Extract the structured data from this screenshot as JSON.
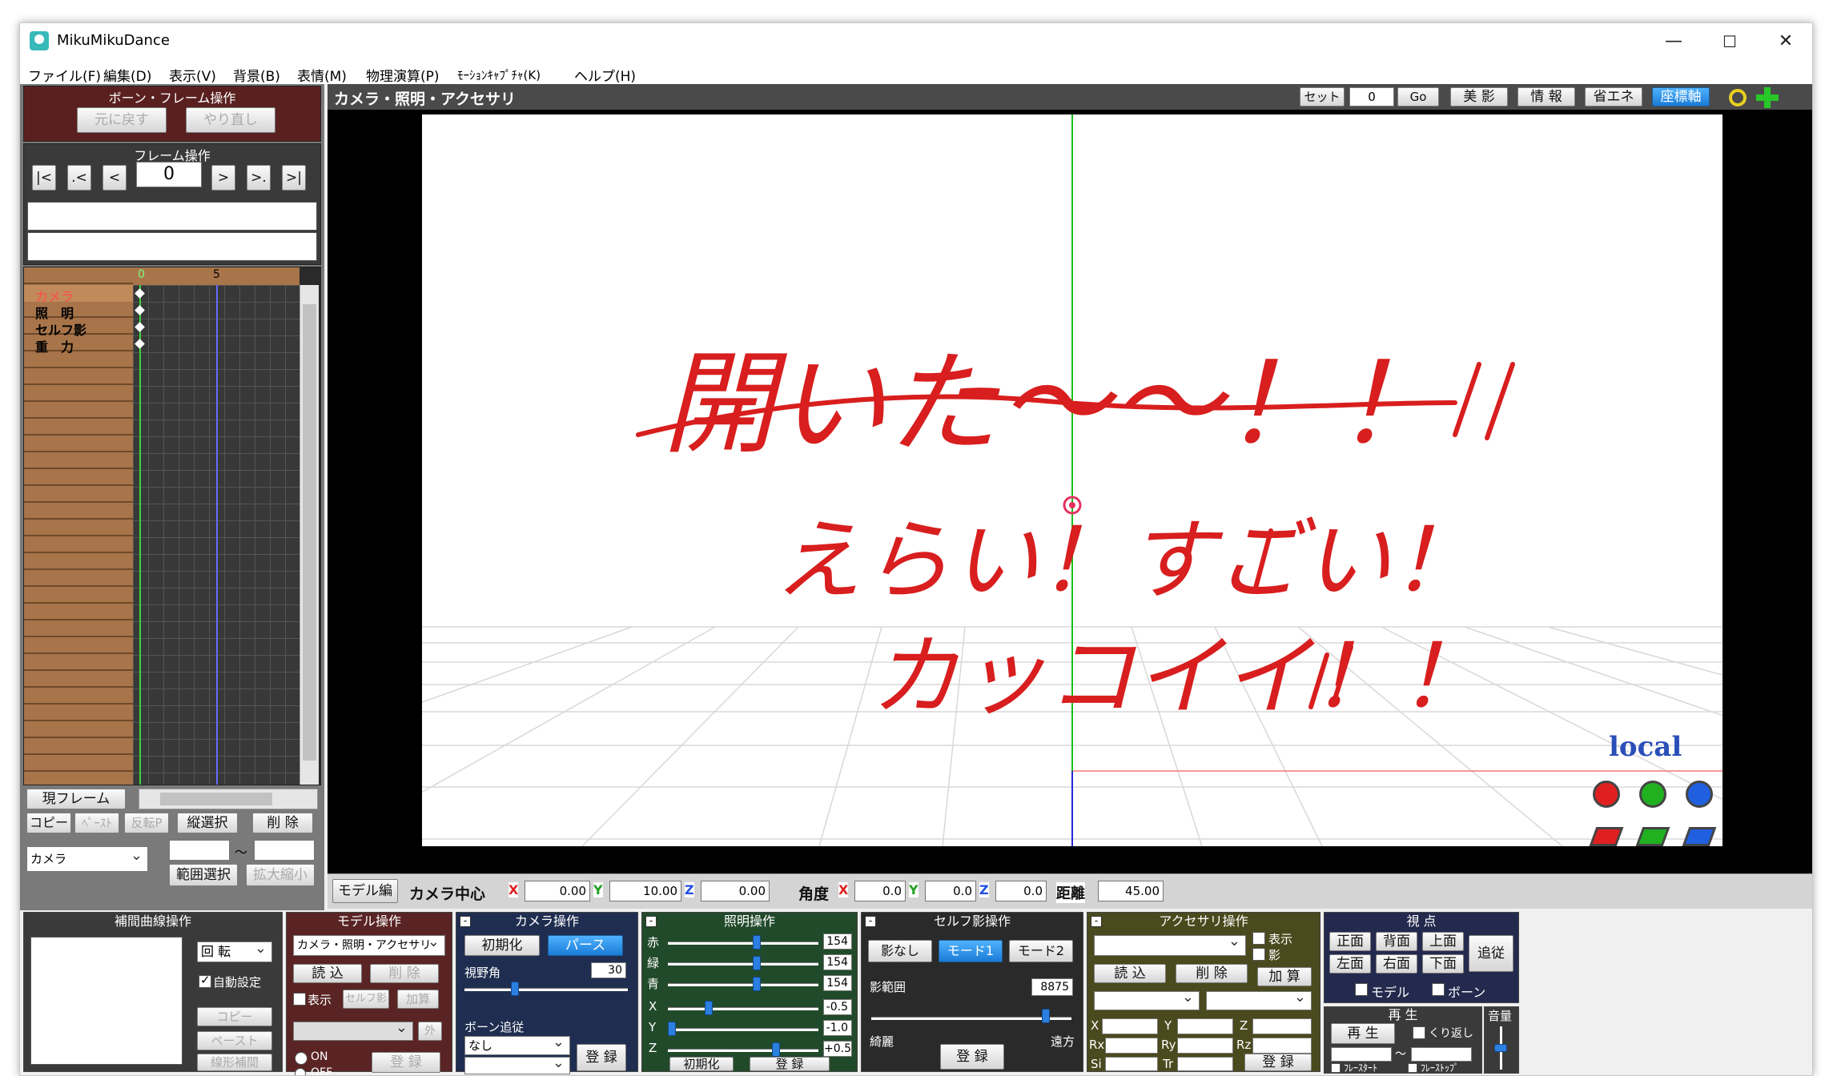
{
  "window": {
    "title": "MikuMikuDance",
    "minimize": "—",
    "maximize": "☐",
    "close": "✕"
  },
  "menu": [
    "ファイル(F)",
    "編集(D)",
    "表示(V)",
    "背景(B)",
    "表情(M)",
    "物理演算(P)",
    "ﾓｰｼｮﾝｷｬﾌﾟﾁｬ(K)",
    "ヘルプ(H)"
  ],
  "bone_frame": {
    "title": "ボーン・フレーム操作",
    "undo": "元に戻す",
    "redo": "やり直し"
  },
  "frame_op": {
    "title": "フレーム操作",
    "first": "|<",
    "prev_key": ".<",
    "prev": "<",
    "frame": "0",
    "next": ">",
    "next_key": ">.",
    "last": ">|"
  },
  "timeline": {
    "tick0": "0",
    "tick5": "5",
    "tracks": [
      "カメラ",
      "照　明",
      "セルフ影",
      "重　力"
    ],
    "current_frame": "現フレーム"
  },
  "edit_buttons": {
    "copy": "コピー",
    "paste": "ﾍﾟｰｽﾄ",
    "reverse": "反転P",
    "vselect": "縦選択",
    "delete": "削 除",
    "range_select": "範囲選択",
    "scale": "拡大縮小",
    "target": "カメラ",
    "tilde": "～"
  },
  "viewport": {
    "header": "カメラ・照明・アクセサリ",
    "set": "セット",
    "frame": "0",
    "go": "Go",
    "beauty": "美 影",
    "info": "情 報",
    "eco": "省エネ",
    "axis": "座標軸",
    "local": "local",
    "note_line1": "開いた～～！！",
    "note_line2": "えらい！すごい！",
    "note_line3": "カッコイイ！！"
  },
  "camera_bar": {
    "model_edit": "モデル編",
    "center": "カメラ中心",
    "x": "X",
    "xv": "0.00",
    "y": "Y",
    "yv": "10.00",
    "z": "Z",
    "zv": "0.00",
    "angle": "角度",
    "ax": "X",
    "axv": "0.0",
    "ay": "Y",
    "ayv": "0.0",
    "az": "Z",
    "azv": "0.0",
    "dist": "距離",
    "distv": "45.00"
  },
  "interp": {
    "title": "補間曲線操作",
    "rotate": "回 転",
    "auto": "自動設定",
    "copy": "コピー",
    "paste": "ペースト",
    "linear": "線形補間"
  },
  "model_op": {
    "title": "モデル操作",
    "select": "カメラ・照明・アクセサリ",
    "load": "読 込",
    "delete": "削 除",
    "show": "表示",
    "self_shadow": "セルフ影",
    "add": "加算",
    "outer": "外",
    "on": "ON",
    "off": "OFF",
    "register": "登 録"
  },
  "camera_op": {
    "title": "カメラ操作",
    "init": "初期化",
    "perspective": "パース",
    "fov_label": "視野角",
    "fov": "30",
    "fov_level": 0.3,
    "follow": "ボーン追従",
    "none": "なし",
    "register": "登 録"
  },
  "light_op": {
    "title": "照明操作",
    "r": "赤",
    "g": "緑",
    "b": "青",
    "x": "X",
    "y": "Y",
    "z": "Z",
    "rv": "154",
    "gv": "154",
    "bv": "154",
    "xv": "-0.5",
    "yv": "-1.0",
    "zv": "+0.5",
    "init": "初期化",
    "register": "登 録"
  },
  "shadow_op": {
    "title": "セルフ影操作",
    "none": "影なし",
    "mode1": "モード1",
    "mode2": "モード2",
    "range": "影範囲",
    "rangev": "8875",
    "near": "綺麗",
    "far": "遠方",
    "register": "登 録",
    "level": 0.8875
  },
  "acc_op": {
    "title": "アクセサリ操作",
    "show": "表示",
    "shadow": "影",
    "load": "読 込",
    "delete": "削 除",
    "add": "加 算",
    "x": "X",
    "y": "Y",
    "z": "Z",
    "rx": "Rx",
    "ry": "Ry",
    "rz": "Rz",
    "si": "Si",
    "tr": "Tr",
    "register": "登 録"
  },
  "view_op": {
    "title": "視 点",
    "front": "正面",
    "back": "背面",
    "top": "上面",
    "follow": "追従",
    "left": "左面",
    "right": "右面",
    "bottom": "下面",
    "model": "モデル",
    "bone": "ボーン"
  },
  "play": {
    "title": "再 生",
    "play": "再 生",
    "loop": "くり返し",
    "frame_start": "ﾌﾚｰｽﾀｰﾄ",
    "frame_stop": "ﾌﾚｰｽﾄｯﾌﾟ",
    "tilde": "～",
    "volume": "音量"
  }
}
